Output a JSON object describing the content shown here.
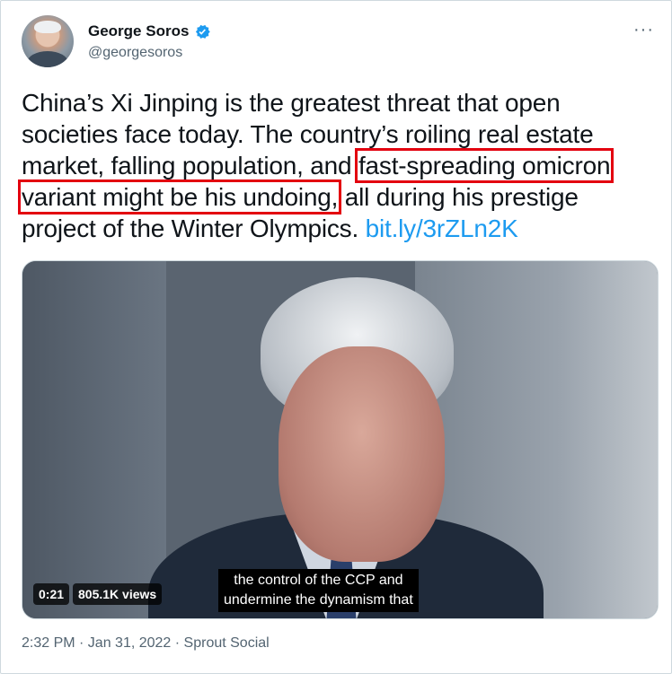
{
  "tweet": {
    "author_name": "George Soros",
    "handle": "@georgesoros",
    "more_label": "···",
    "text_lines": {
      "l1": "China’s Xi Jinping is the greatest threat that open",
      "l2": "societies face today. The country’s roiling real estate",
      "l3_plain": "market, falling population, and ",
      "l3_highlight": "fast-spreading omicron",
      "l4_highlight": "variant might be his undoing,",
      "l4_plain": " all during his prestige",
      "l5_plain": "project of the Winter Olympics. ",
      "link": "bit.ly/3rZLn2K"
    },
    "video": {
      "caption_line1": "the control of the CCP and",
      "caption_line2": "undermine the dynamism that",
      "time": "0:21",
      "views": "805.1K views"
    },
    "meta": "2:32 PM · Jan 31, 2022 · Sprout Social"
  },
  "colors": {
    "link": "#1d9bf0",
    "verified": "#1d9bf0",
    "highlight_box": "#e3000f",
    "secondary_text": "#536471"
  }
}
